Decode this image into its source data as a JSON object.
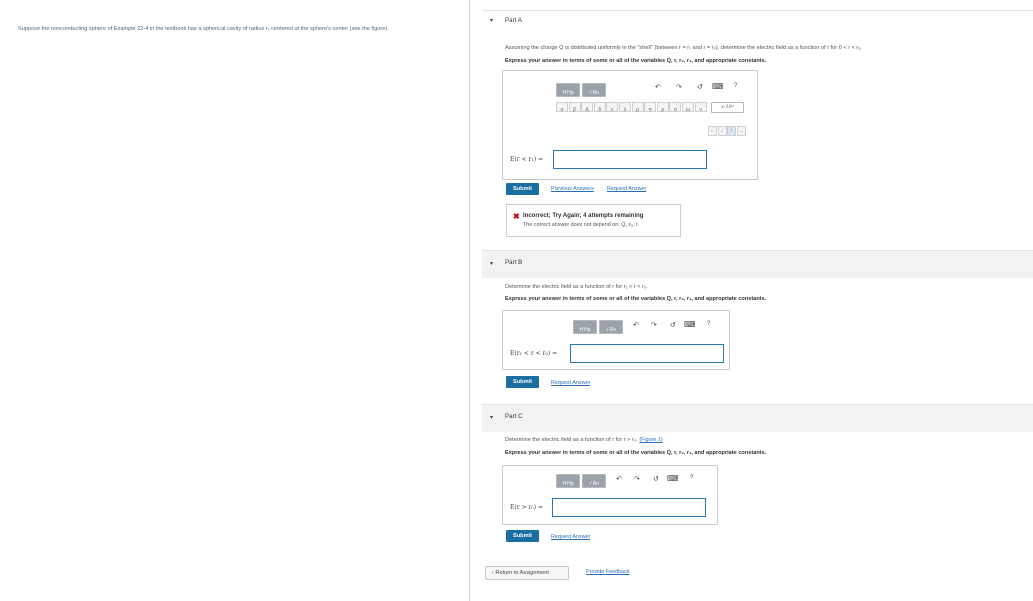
{
  "intro_text": "Suppose the nonconducting sphere of Example 22-4 in the textbook has a spherical cavity of radius r₁ centered at the sphere's center (see the figure).",
  "parts": {
    "a": {
      "label": "Part A",
      "caret": "▾",
      "question": "Assuming the charge Q is distributed uniformly in the \"shell\" (between r = r₁ and r = r₀), determine the electric field as a function of r for 0 < r < r₁.",
      "instruction": "Express your answer in terms of some or all of the variables Q, r, r₀, r₁, and appropriate constants.",
      "toolbar": {
        "templates_a": "H Hp",
        "templates_b": "√ Ro",
        "undo_icon": "↶",
        "redo_icon": "↷",
        "reset_icon": "↺",
        "keyboard_icon": "⌨",
        "help_icon": "?",
        "scientific": "x·10ⁿ",
        "symbols": [
          "α",
          "β",
          "Δ",
          "δ",
          "ε",
          "λ",
          "μ",
          "π",
          "ρ",
          "σ",
          "ω",
          "ν"
        ],
        "extra": [
          "←",
          "↓",
          "↑",
          "→"
        ]
      },
      "equation_label": "E(r < r₁) =",
      "submit_label": "Submit",
      "previous_answers_label": "Previous Answers",
      "request_answer_label": "Request Answer",
      "feedback": {
        "icon": "✖",
        "title": "Incorrect; Try Again; 4 attempts remaining",
        "detail": "The correct answer does not depend on: Q, ε₀, r."
      }
    },
    "b": {
      "label": "Part B",
      "caret": "▾",
      "question": "Determine the electric field as a function of r for r₁ < r < r₀.",
      "instruction": "Express your answer in terms of some or all of the variables Q, r, r₀, r₁, and appropriate constants.",
      "toolbar": {
        "templates_a": "H Hp",
        "templates_b": "√ Ro",
        "undo_icon": "↶",
        "redo_icon": "↷",
        "reset_icon": "↺",
        "keyboard_icon": "⌨",
        "help_icon": "?"
      },
      "equation_label": "E(r₁ < r < r₀) =",
      "submit_label": "Submit",
      "request_answer_label": "Request Answer"
    },
    "c": {
      "label": "Part C",
      "caret": "▾",
      "question": "Determine the electric field as a function of r for r > r₀.",
      "figure_link": "(Figure 1)",
      "instruction": "Express your answer in terms of some or all of the variables Q, r, r₀, r₁, and appropriate constants.",
      "toolbar": {
        "templates_a": "H Hp",
        "templates_b": "√ Ro",
        "undo_icon": "↶",
        "redo_icon": "↷",
        "reset_icon": "↺",
        "keyboard_icon": "⌨",
        "help_icon": "?"
      },
      "equation_label": "E(r > r₀) =",
      "submit_label": "Submit",
      "request_answer_label": "Request Answer"
    }
  },
  "footer": {
    "return_label": "‹ Return to Assignment",
    "feedback_label": "Provide Feedback"
  },
  "colors": {
    "submit": "#1a6fa0",
    "link": "#2a6ebd",
    "error": "#d0021b",
    "input_border": "#2a7ab0"
  }
}
